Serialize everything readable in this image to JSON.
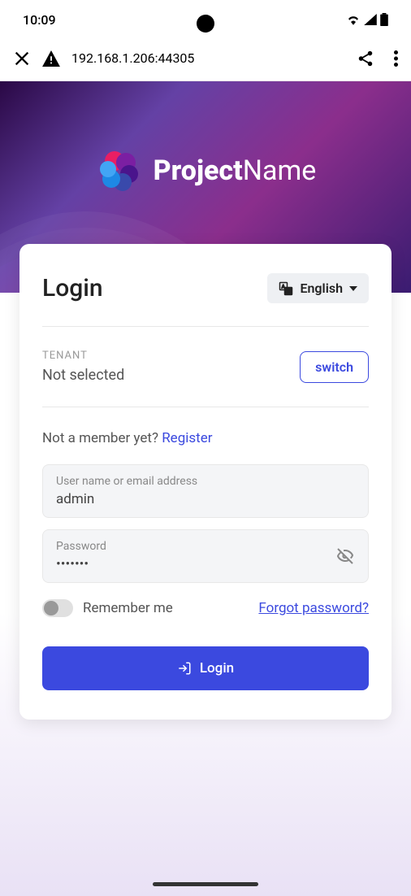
{
  "status": {
    "time": "10:09"
  },
  "browser": {
    "url": "192.168.1.206:44305"
  },
  "brand": {
    "name_bold": "Project",
    "name_light": "Name"
  },
  "login": {
    "title": "Login",
    "language": "English",
    "tenant_label": "TENANT",
    "tenant_value": "Not selected",
    "switch_label": "switch",
    "not_member_text": "Not a member yet? ",
    "register_label": "Register",
    "username_label": "User name or email address",
    "username_value": "admin",
    "password_label": "Password",
    "password_value": "•••••••",
    "remember_label": "Remember me",
    "forgot_label": "Forgot password?",
    "login_button": "Login"
  },
  "colors": {
    "primary": "#3b49df",
    "bg_gradient_start": "#2a0845",
    "bg_gradient_end": "#6441a5"
  }
}
